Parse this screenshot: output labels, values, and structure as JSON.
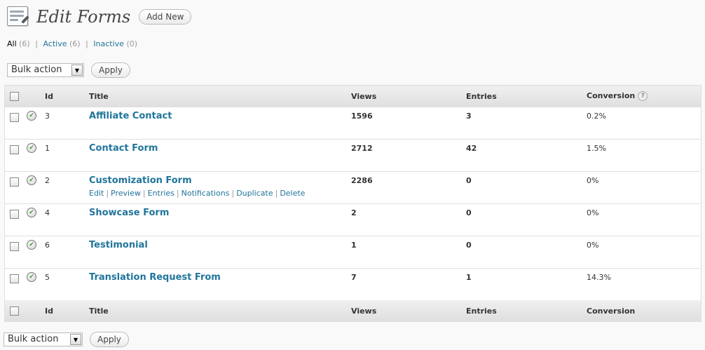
{
  "header": {
    "title": "Edit Forms",
    "add_new": "Add New"
  },
  "filters": [
    {
      "label": "All",
      "count": "(6)",
      "current": true
    },
    {
      "label": "Active",
      "count": "(6)",
      "current": false
    },
    {
      "label": "Inactive",
      "count": "(0)",
      "current": false
    }
  ],
  "bulk_top": {
    "select_value": "Bulk action",
    "apply": "Apply"
  },
  "bulk_bottom": {
    "select_value": "Bulk action",
    "apply": "Apply"
  },
  "table": {
    "columns": {
      "id": "Id",
      "title": "Title",
      "views": "Views",
      "entries": "Entries",
      "conversion": "Conversion"
    },
    "rows": [
      {
        "id": "3",
        "title": "Affiliate Contact",
        "views": "1596",
        "entries": "3",
        "conversion": "0.2%"
      },
      {
        "id": "1",
        "title": "Contact Form",
        "views": "2712",
        "entries": "42",
        "conversion": "1.5%"
      },
      {
        "id": "2",
        "title": "Customization Form",
        "views": "2286",
        "entries": "0",
        "conversion": "0%"
      },
      {
        "id": "4",
        "title": "Showcase Form",
        "views": "2",
        "entries": "0",
        "conversion": "0%"
      },
      {
        "id": "6",
        "title": "Testimonial",
        "views": "1",
        "entries": "0",
        "conversion": "0%"
      },
      {
        "id": "5",
        "title": "Translation Request From",
        "views": "7",
        "entries": "1",
        "conversion": "14.3%"
      }
    ],
    "row_actions": [
      "Edit",
      "Preview",
      "Entries",
      "Notifications",
      "Duplicate",
      "Delete"
    ]
  },
  "icons": {
    "page": "forms-page-icon",
    "status": "active-check-icon",
    "help": "help-icon"
  },
  "colors": {
    "link": "#21759b",
    "background": "#f9f9f9"
  }
}
